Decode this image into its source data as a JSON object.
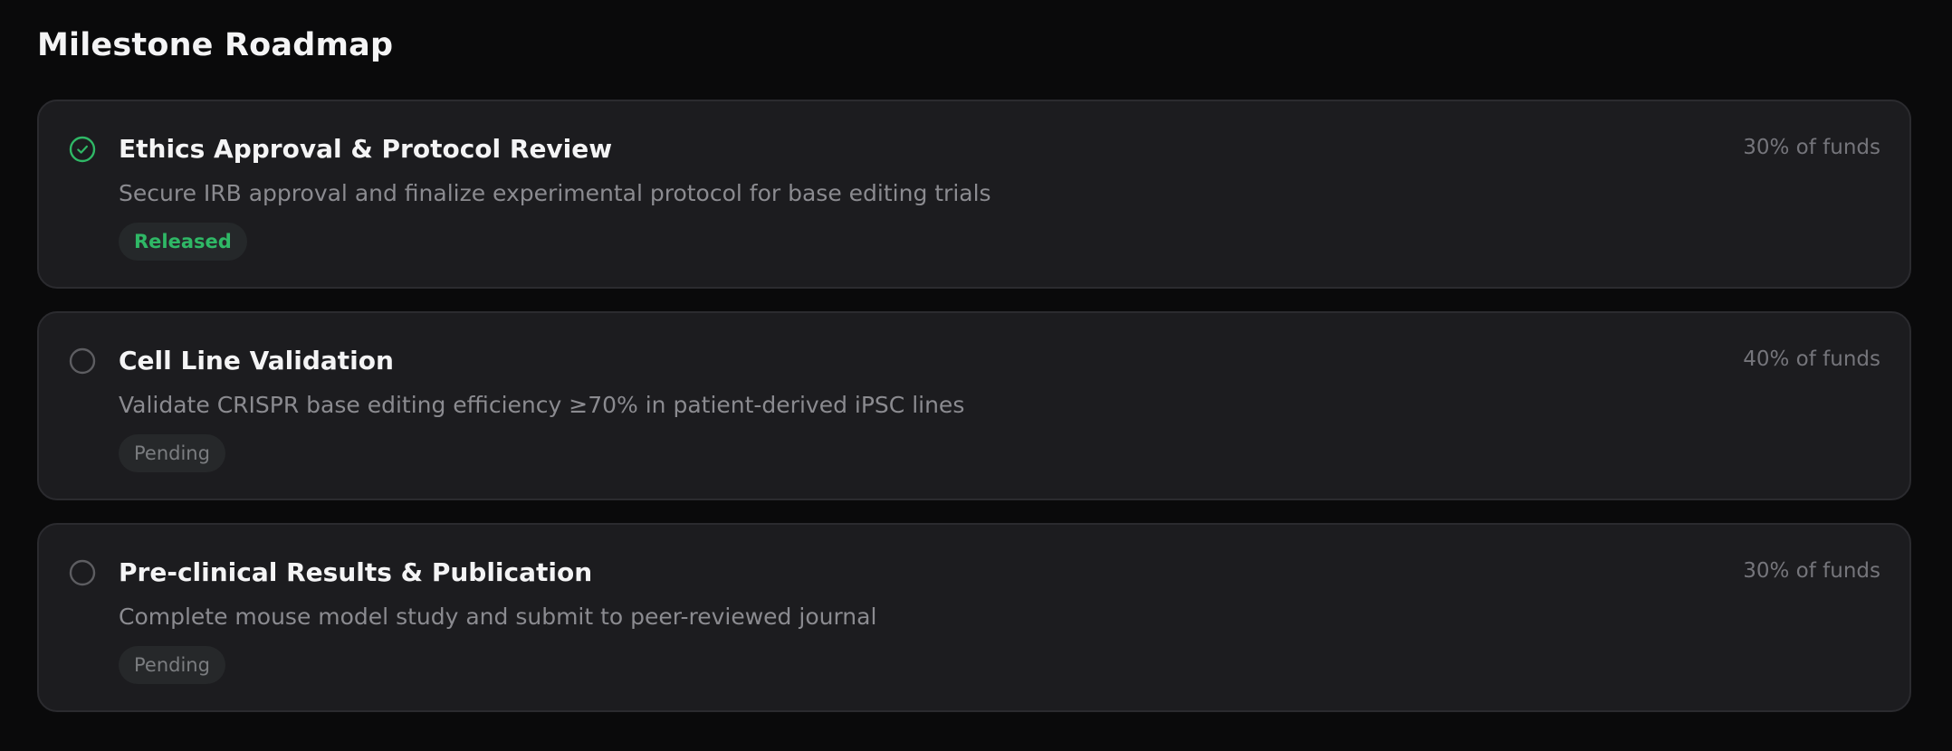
{
  "page": {
    "title": "Milestone Roadmap"
  },
  "colors": {
    "background": "#0a0a0b",
    "card": "#1c1c1f",
    "released": "#2fb866",
    "pending": "#7b7d80"
  },
  "milestones": [
    {
      "title": "Ethics Approval & Protocol Review",
      "description": "Secure IRB approval and finalize experimental protocol for base editing trials",
      "share": "30% of funds",
      "status": "Released",
      "icon": "check-circle-icon"
    },
    {
      "title": "Cell Line Validation",
      "description": "Validate CRISPR base editing efficiency ≥70% in patient-derived iPSC lines",
      "share": "40% of funds",
      "status": "Pending",
      "icon": "empty-circle-icon"
    },
    {
      "title": "Pre-clinical Results & Publication",
      "description": "Complete mouse model study and submit to peer-reviewed journal",
      "share": "30% of funds",
      "status": "Pending",
      "icon": "empty-circle-icon"
    }
  ]
}
